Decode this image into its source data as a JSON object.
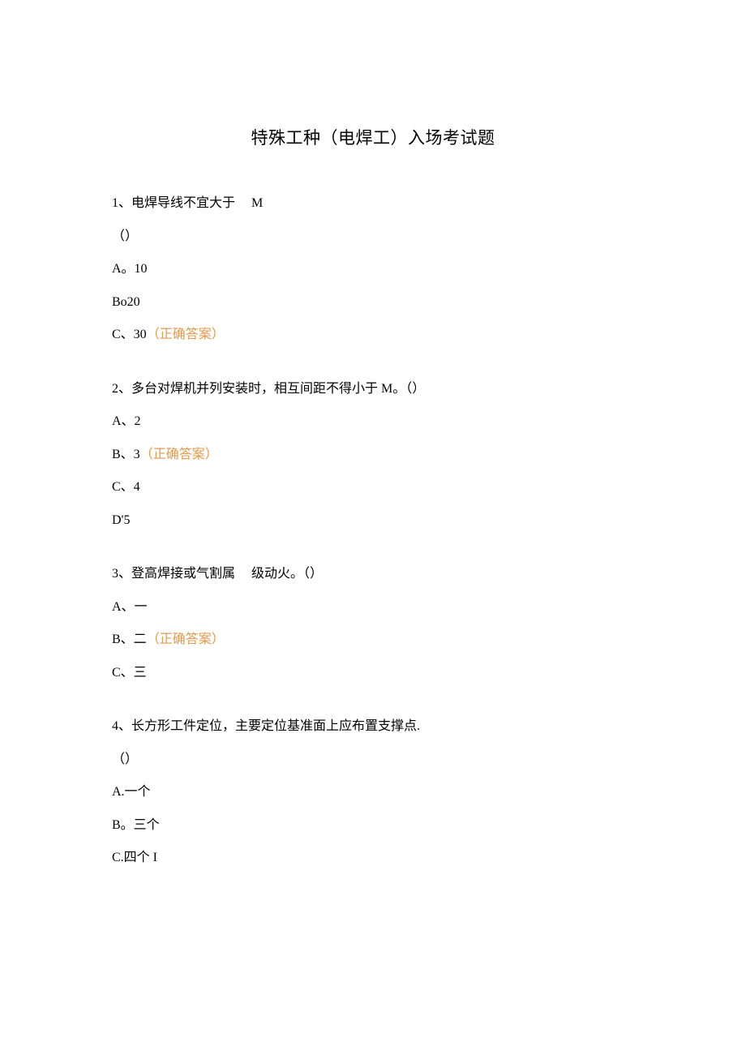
{
  "title": "特殊工种（电焊工）入场考试题",
  "correct_label": "（正确答案）",
  "questions": [
    {
      "lines": [
        "1、电焊导线不宜大于     M",
        "（）"
      ],
      "options": [
        {
          "text": "A。10",
          "correct": false
        },
        {
          "text": "Bo20",
          "correct": false
        },
        {
          "text": "C、30",
          "correct": true
        }
      ]
    },
    {
      "lines": [
        "2、多台对焊机并列安装时，相互间距不得小于 M。（）"
      ],
      "options": [
        {
          "text": "A、2",
          "correct": false
        },
        {
          "text": "B、3",
          "correct": true
        },
        {
          "text": "C、4",
          "correct": false
        },
        {
          "text": "D'5",
          "correct": false
        }
      ]
    },
    {
      "lines": [
        "3、登高焊接或气割属     级动火。（）"
      ],
      "options": [
        {
          "text": "A、一",
          "correct": false
        },
        {
          "text": "B、二",
          "correct": true
        },
        {
          "text": "C、三",
          "correct": false
        }
      ]
    },
    {
      "lines": [
        "4、长方形工件定位，主要定位基准面上应布置支撑点.",
        "（）"
      ],
      "options": [
        {
          "text": "A.一个",
          "correct": false
        },
        {
          "text": "B。三个",
          "correct": false
        },
        {
          "text": "C.四个 I",
          "correct": false
        }
      ]
    }
  ]
}
